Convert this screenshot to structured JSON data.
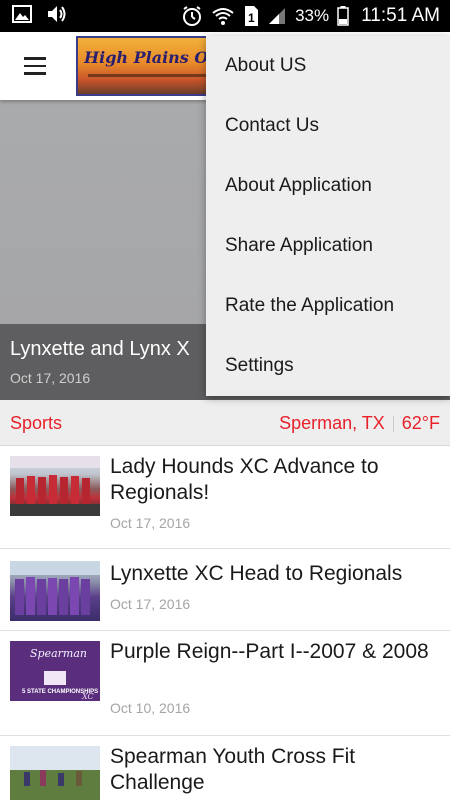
{
  "status_bar": {
    "battery_percent": "33%",
    "time": "11:51 AM",
    "icons": [
      "image-icon",
      "volume-icon",
      "alarm-icon",
      "wifi-icon",
      "sim-icon",
      "signal-icon",
      "battery-icon"
    ]
  },
  "toolbar": {
    "logo_text": "High Plains Obse"
  },
  "featured": {
    "title": "Lynxette and Lynx X",
    "date": "Oct 17, 2016"
  },
  "infobar": {
    "category": "Sports",
    "location": "Sperman, TX",
    "temperature": "62°F"
  },
  "articles": [
    {
      "title": "Lady Hounds XC Advance to Regionals!",
      "date": "Oct 17, 2016"
    },
    {
      "title": "Lynxette XC Head to Regionals",
      "date": "Oct 17, 2016"
    },
    {
      "title": "Purple Reign--Part I--2007 & 2008",
      "date": "Oct 10, 2016"
    },
    {
      "title": "Spearman Youth Cross Fit Challenge",
      "date": ""
    }
  ],
  "thumb_text": {
    "spearman": "Spearman",
    "championships": "5 STATE CHAMPIONSHIPS",
    "xc": "XC"
  },
  "menu": {
    "items": [
      "About US",
      "Contact Us",
      "About Application",
      "Share Application",
      "Rate the Application",
      "Settings"
    ]
  },
  "colors": {
    "accent_red": "#e8212b",
    "menu_bg": "#eeeeee",
    "status_bar": "#000000"
  }
}
